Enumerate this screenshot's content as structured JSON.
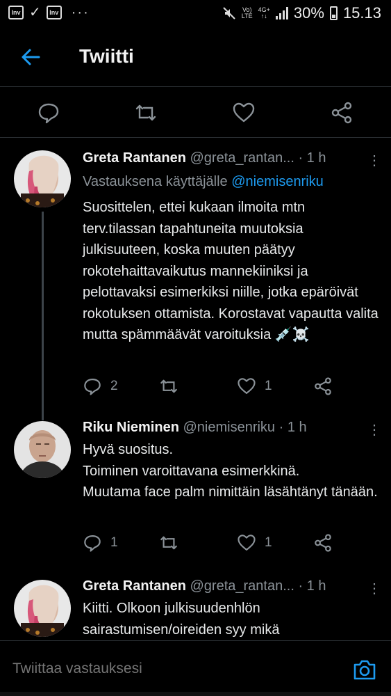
{
  "status_bar": {
    "app_icon_1": "Inv",
    "app_icon_2": "Inv",
    "dots": "···",
    "network_top": "Vo)",
    "network_bottom": "LTE",
    "data_top": "4G+",
    "data_bottom": "↑↓",
    "battery": "30%",
    "time": "15.13"
  },
  "header": {
    "title": "Twiitti"
  },
  "tweets": [
    {
      "name": "Greta Rantanen",
      "handle": "@greta_rantan...",
      "time": "· 1 h",
      "reply_prefix": "Vastauksena käyttäjälle",
      "reply_mention": "@niemisenriku",
      "text": "Suosittelen, ettei kukaan ilmoita mtn terv.tilassan tapahtuneita muutoksia julkisuuteen, koska muuten päätyy rokotehaittavaikutus mannekiiniksi ja pelottavaksi esimerkiksi niille, jotka epäröivät rokotuksen ottamista. Korostavat vapautta valita mutta spämmäävät varoituksia 💉☠️",
      "replies": "2",
      "likes": "1"
    },
    {
      "name": "Riku Nieminen",
      "handle": "@niemisenriku",
      "time": "· 1 h",
      "text_lines": [
        "Hyvä suositus.",
        "Toiminen varoittavana esimerkkinä.",
        "Muutama face palm nimittäin läsähtänyt tänään."
      ],
      "replies": "1",
      "likes": "1"
    },
    {
      "name": "Greta Rantanen",
      "handle": "@greta_rantan...",
      "time": "· 1 h",
      "text": "Kiitti. Olkoon julkisuudenhlön sairastumisen/oireiden syy mikä"
    }
  ],
  "reply_bar": {
    "placeholder": "Twiittaa vastauksesi"
  },
  "colors": {
    "background": "#000000",
    "accent": "#1d9bf0",
    "muted": "#8b9298",
    "text": "#e7e9ea"
  }
}
